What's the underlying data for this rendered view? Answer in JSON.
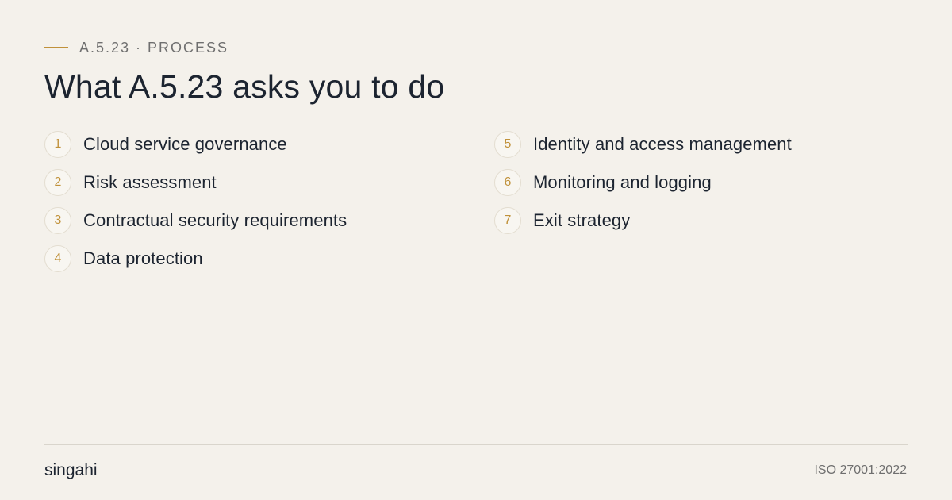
{
  "eyebrow": {
    "label": "A.5.23 · PROCESS"
  },
  "title": "What A.5.23 asks you to do",
  "steps": {
    "left": [
      {
        "number": "1",
        "label": "Cloud service governance"
      },
      {
        "number": "2",
        "label": "Risk assessment"
      },
      {
        "number": "3",
        "label": "Contractual security requirements"
      },
      {
        "number": "4",
        "label": "Data protection"
      }
    ],
    "right": [
      {
        "number": "5",
        "label": "Identity and access management"
      },
      {
        "number": "6",
        "label": "Monitoring and logging"
      },
      {
        "number": "7",
        "label": "Exit strategy"
      }
    ]
  },
  "footer": {
    "brand": "singahi",
    "standard": "ISO 27001:2022"
  },
  "colors": {
    "background": "#f4f1eb",
    "accent": "#c0913a",
    "text": "#1c2430",
    "muted": "#6f6f6f"
  }
}
